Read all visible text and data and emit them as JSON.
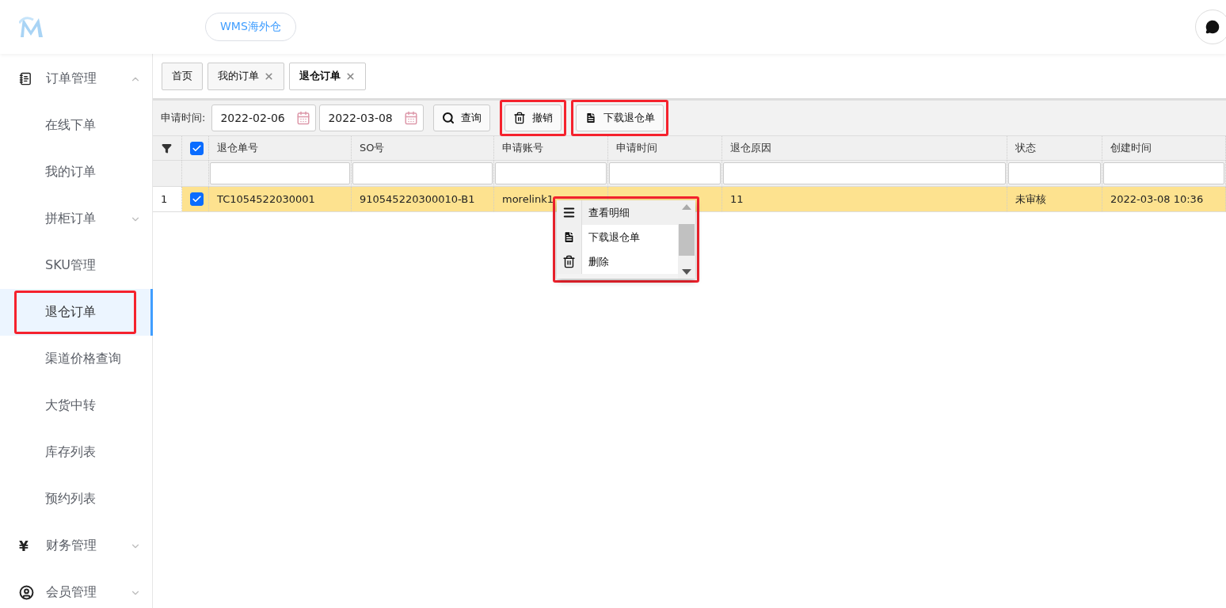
{
  "header": {
    "system_button": "WMS海外仓"
  },
  "sidebar": {
    "items": [
      {
        "label": "订单管理",
        "expanded": true,
        "selected": false,
        "highlighted": false,
        "children": [
          {
            "label": "在线下单",
            "selected": false,
            "highlighted": false
          },
          {
            "label": "我的订单",
            "selected": false,
            "highlighted": false
          },
          {
            "label": "拼柜订单",
            "selected": false,
            "highlighted": false,
            "expanded": false
          },
          {
            "label": "SKU管理",
            "selected": false,
            "highlighted": false
          },
          {
            "label": "退仓订单",
            "selected": true,
            "highlighted": true
          },
          {
            "label": "渠道价格查询",
            "selected": false,
            "highlighted": false
          },
          {
            "label": "大货中转",
            "selected": false,
            "highlighted": false
          },
          {
            "label": "库存列表",
            "selected": false,
            "highlighted": false
          },
          {
            "label": "预约列表",
            "selected": false,
            "highlighted": false
          }
        ]
      },
      {
        "label": "财务管理",
        "symbol": "¥",
        "expanded": false,
        "selected": false,
        "highlighted": false
      },
      {
        "label": "会员管理",
        "expanded": false,
        "selected": false,
        "highlighted": false
      }
    ]
  },
  "tabs": [
    {
      "label": "首页",
      "selected": false,
      "closable": false
    },
    {
      "label": "我的订单",
      "selected": false,
      "closable": true
    },
    {
      "label": "退仓订单",
      "selected": true,
      "closable": true
    }
  ],
  "toolbar": {
    "date_label": "申请时间:",
    "date_from": "2022-02-06",
    "date_to": "2022-03-08",
    "buttons": [
      {
        "label": "查询",
        "highlighted": false
      },
      {
        "label": "撤销",
        "highlighted": true
      },
      {
        "label": "下载退仓单",
        "highlighted": true
      }
    ]
  },
  "table": {
    "all_checked": true,
    "columns": [
      "退仓单号",
      "SO号",
      "申请账号",
      "申请时间",
      "退仓原因",
      "状态",
      "创建时间"
    ],
    "rows": [
      {
        "index": "1",
        "checked": true,
        "selected": true,
        "cells": [
          "TC1054522030001",
          "910545220300010-B1",
          "morelink1",
          null,
          "11",
          "未审核",
          "2022-03-08 10:36"
        ]
      }
    ]
  },
  "context_menu": {
    "highlighted": true,
    "items": [
      {
        "label": "查看明细",
        "selected": true
      },
      {
        "label": "下载退仓单",
        "selected": false
      },
      {
        "label": "删除",
        "selected": false
      }
    ]
  }
}
